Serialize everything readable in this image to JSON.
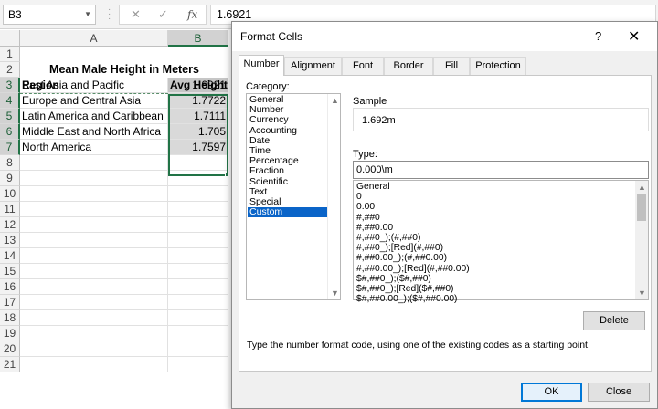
{
  "formula_bar": {
    "name_box": "B3",
    "cancel_icon": "✕",
    "enter_icon": "✓",
    "fx_label": "fx",
    "value": "1.6921"
  },
  "sheet": {
    "columns": [
      "A",
      "B"
    ],
    "rows": [
      "1",
      "2",
      "3",
      "4",
      "5",
      "6",
      "7",
      "8",
      "9",
      "10",
      "11",
      "12",
      "13",
      "14",
      "15",
      "16",
      "17",
      "18",
      "19",
      "20",
      "21"
    ],
    "title": "Mean Male Height in Meters",
    "header_region": "Region",
    "header_avg": "Avg Height",
    "data": [
      {
        "region": "East Asia and Pacific",
        "value": "1.6921"
      },
      {
        "region": "Europe and Central Asia",
        "value": "1.7722"
      },
      {
        "region": "Latin America and Caribbean",
        "value": "1.7111"
      },
      {
        "region": "Middle East and North Africa",
        "value": "1.705"
      },
      {
        "region": "North America",
        "value": "1.7597"
      }
    ]
  },
  "dialog": {
    "title": "Format Cells",
    "help_icon": "?",
    "close_icon": "✕",
    "tabs": [
      "Number",
      "Alignment",
      "Font",
      "Border",
      "Fill",
      "Protection"
    ],
    "category_label": "Category:",
    "categories": [
      "General",
      "Number",
      "Currency",
      "Accounting",
      "Date",
      "Time",
      "Percentage",
      "Fraction",
      "Scientific",
      "Text",
      "Special",
      "Custom"
    ],
    "selected_category": "Custom",
    "sample_label": "Sample",
    "sample_value": "1.692m",
    "type_label": "Type:",
    "type_value": "0.000\\m",
    "formats": [
      "General",
      "0",
      "0.00",
      "#,##0",
      "#,##0.00",
      "#,##0_);(#,##0)",
      "#,##0_);[Red](#,##0)",
      "#,##0.00_);(#,##0.00)",
      "#,##0.00_);[Red](#,##0.00)",
      "$#,##0_);($#,##0)",
      "$#,##0_);[Red]($#,##0)",
      "$#,##0.00_);($#,##0.00)"
    ],
    "delete_label": "Delete",
    "hint": "Type the number format code, using one of the existing codes as a starting point.",
    "ok_label": "OK",
    "close_label": "Close"
  }
}
